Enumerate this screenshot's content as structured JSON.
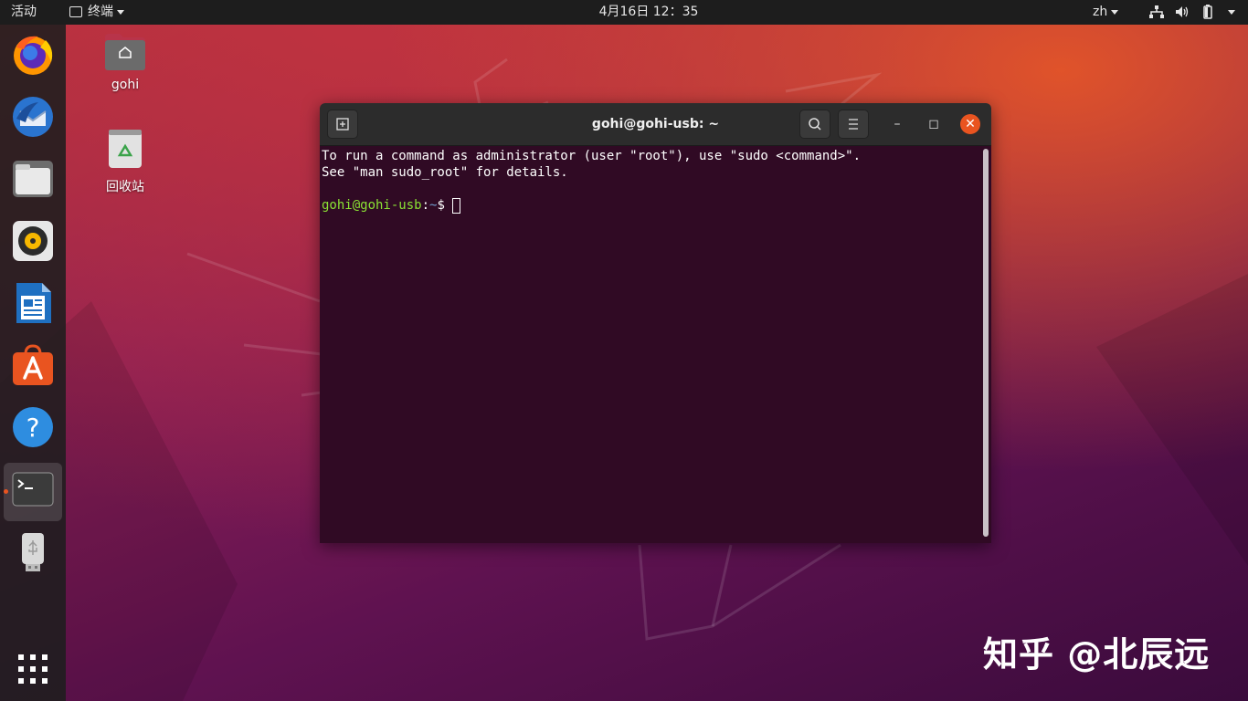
{
  "topbar": {
    "activities": "活动",
    "app_menu": "终端",
    "clock": "4月16日  12：35",
    "language": "zh"
  },
  "desktop": {
    "home_label": "gohi",
    "trash_label": "回收站"
  },
  "dock": {
    "items": [
      {
        "name": "firefox",
        "icon": "firefox-icon"
      },
      {
        "name": "thunderbird",
        "icon": "thunderbird-icon"
      },
      {
        "name": "files",
        "icon": "files-icon"
      },
      {
        "name": "rhythmbox",
        "icon": "rhythmbox-icon"
      },
      {
        "name": "libreoffice-writer",
        "icon": "writer-icon"
      },
      {
        "name": "software",
        "icon": "software-center-icon"
      },
      {
        "name": "help",
        "icon": "help-icon"
      },
      {
        "name": "terminal",
        "icon": "terminal-icon",
        "active": true
      },
      {
        "name": "usb",
        "icon": "usb-drive-icon"
      },
      {
        "name": "show-apps",
        "icon": "app-grid-icon"
      }
    ]
  },
  "terminal": {
    "title": "gohi@gohi-usb: ~",
    "line1": "To run a command as administrator (user \"root\"), use \"sudo <command>\".",
    "line2": "See \"man sudo_root\" for details.",
    "prompt_user": "gohi@gohi-usb",
    "prompt_sep": ":",
    "prompt_path": "~",
    "prompt_symbol": "$ ",
    "minimize": "–",
    "maximize": "◻",
    "close": "✕"
  },
  "watermark": "知乎 @北辰远",
  "colors": {
    "accent": "#e95420",
    "terminal_bg": "#300a24",
    "prompt_user": "#8ae234",
    "prompt_path": "#729fcf"
  }
}
